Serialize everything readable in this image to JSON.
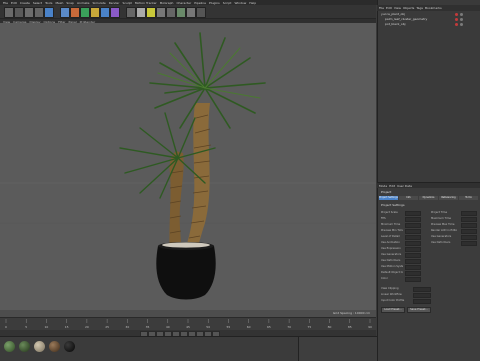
{
  "menubar": {
    "items": [
      "File",
      "Edit",
      "Create",
      "Select",
      "Tools",
      "Mesh",
      "Snap",
      "Animate",
      "Simulate",
      "Render",
      "Sculpt",
      "Motion Tracker",
      "MoGraph",
      "Character",
      "Pipeline",
      "Plugins",
      "Script",
      "Window",
      "Help"
    ]
  },
  "viewport_menu": {
    "items": [
      "View",
      "Cameras",
      "Display",
      "Options",
      "Filter",
      "Panel",
      "ProRender"
    ]
  },
  "object_manager": {
    "menu": [
      "File",
      "Edit",
      "View",
      "Objects",
      "Tags",
      "Bookmarks"
    ],
    "rows": [
      "yucca_plant_obj",
      "palm_leaf_cluster_geometry",
      "pot_black_obj"
    ]
  },
  "attribute_manager": {
    "menu": [
      "Mode",
      "Edit",
      "User Data"
    ],
    "object_label": "Project",
    "tabs": [
      "Project Settings",
      "Info",
      "Dynamics",
      "Referencing",
      "To Do"
    ],
    "section": "Project Settings",
    "fields_left": [
      "Project Scale",
      "FPS",
      "Minimum Time",
      "Preview Min Time",
      "Level of Detail",
      "Use Animation",
      "Use Expression",
      "Use Generators",
      "Use Deformers",
      "Use Motion System",
      "Default Object Color",
      "Color"
    ],
    "fields_right": [
      "Project Time",
      "Maximum Time",
      "Preview Max Time",
      "Render LOD in Editor",
      "Use Generators",
      "Use Deformers"
    ],
    "extra_labels": [
      "View Clipping",
      "Linear Workflow",
      "Input Color Profile"
    ],
    "buttons": [
      "Load Preset...",
      "Save Preset..."
    ]
  },
  "timeline": {
    "frame_start": "0",
    "frame_end": "90",
    "ticks": [
      "0",
      "5",
      "10",
      "15",
      "20",
      "25",
      "30",
      "35",
      "40",
      "45",
      "50",
      "55",
      "60",
      "65",
      "70",
      "75",
      "80",
      "85",
      "90"
    ]
  },
  "status": {
    "text": "Grid Spacing : 10000 cm"
  },
  "colors": {
    "accent": "#4a82c8",
    "bg": "#3a3a3a",
    "viewport": "#585858",
    "pot": "#0f0f0f",
    "leaf": "#2f5a22",
    "trunk": "#8a6a3a"
  }
}
